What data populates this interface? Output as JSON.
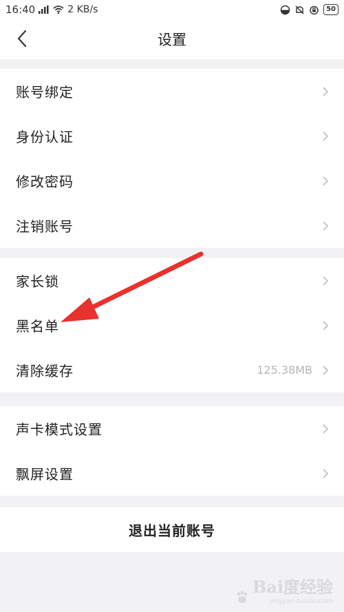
{
  "status_bar": {
    "time": "16:40",
    "network_speed": "2 KB/s",
    "battery": "50",
    "icons": [
      "signal-icon",
      "wifi-icon",
      "theme-icon",
      "bell-off-icon",
      "alarm-icon",
      "battery-icon"
    ]
  },
  "header": {
    "title": "设置",
    "back_icon": "chevron-left-icon"
  },
  "groups": [
    {
      "items": [
        {
          "label": "账号绑定"
        },
        {
          "label": "身份认证"
        },
        {
          "label": "修改密码"
        },
        {
          "label": "注销账号"
        }
      ]
    },
    {
      "items": [
        {
          "label": "家长锁"
        },
        {
          "label": "黑名单"
        },
        {
          "label": "清除缓存",
          "value": "125.38MB"
        }
      ]
    },
    {
      "items": [
        {
          "label": "声卡模式设置"
        },
        {
          "label": "飘屏设置"
        }
      ]
    }
  ],
  "logout": {
    "label": "退出当前账号"
  },
  "annotation": {
    "color": "#e8322e"
  },
  "watermark": {
    "text": "Bai度经验",
    "sub": "jingyan.baidu.com"
  },
  "colors": {
    "background": "#f2f2f5",
    "card": "#ffffff",
    "text": "#222222",
    "muted": "#b5b5b5",
    "chevron": "#bdbdbd"
  }
}
